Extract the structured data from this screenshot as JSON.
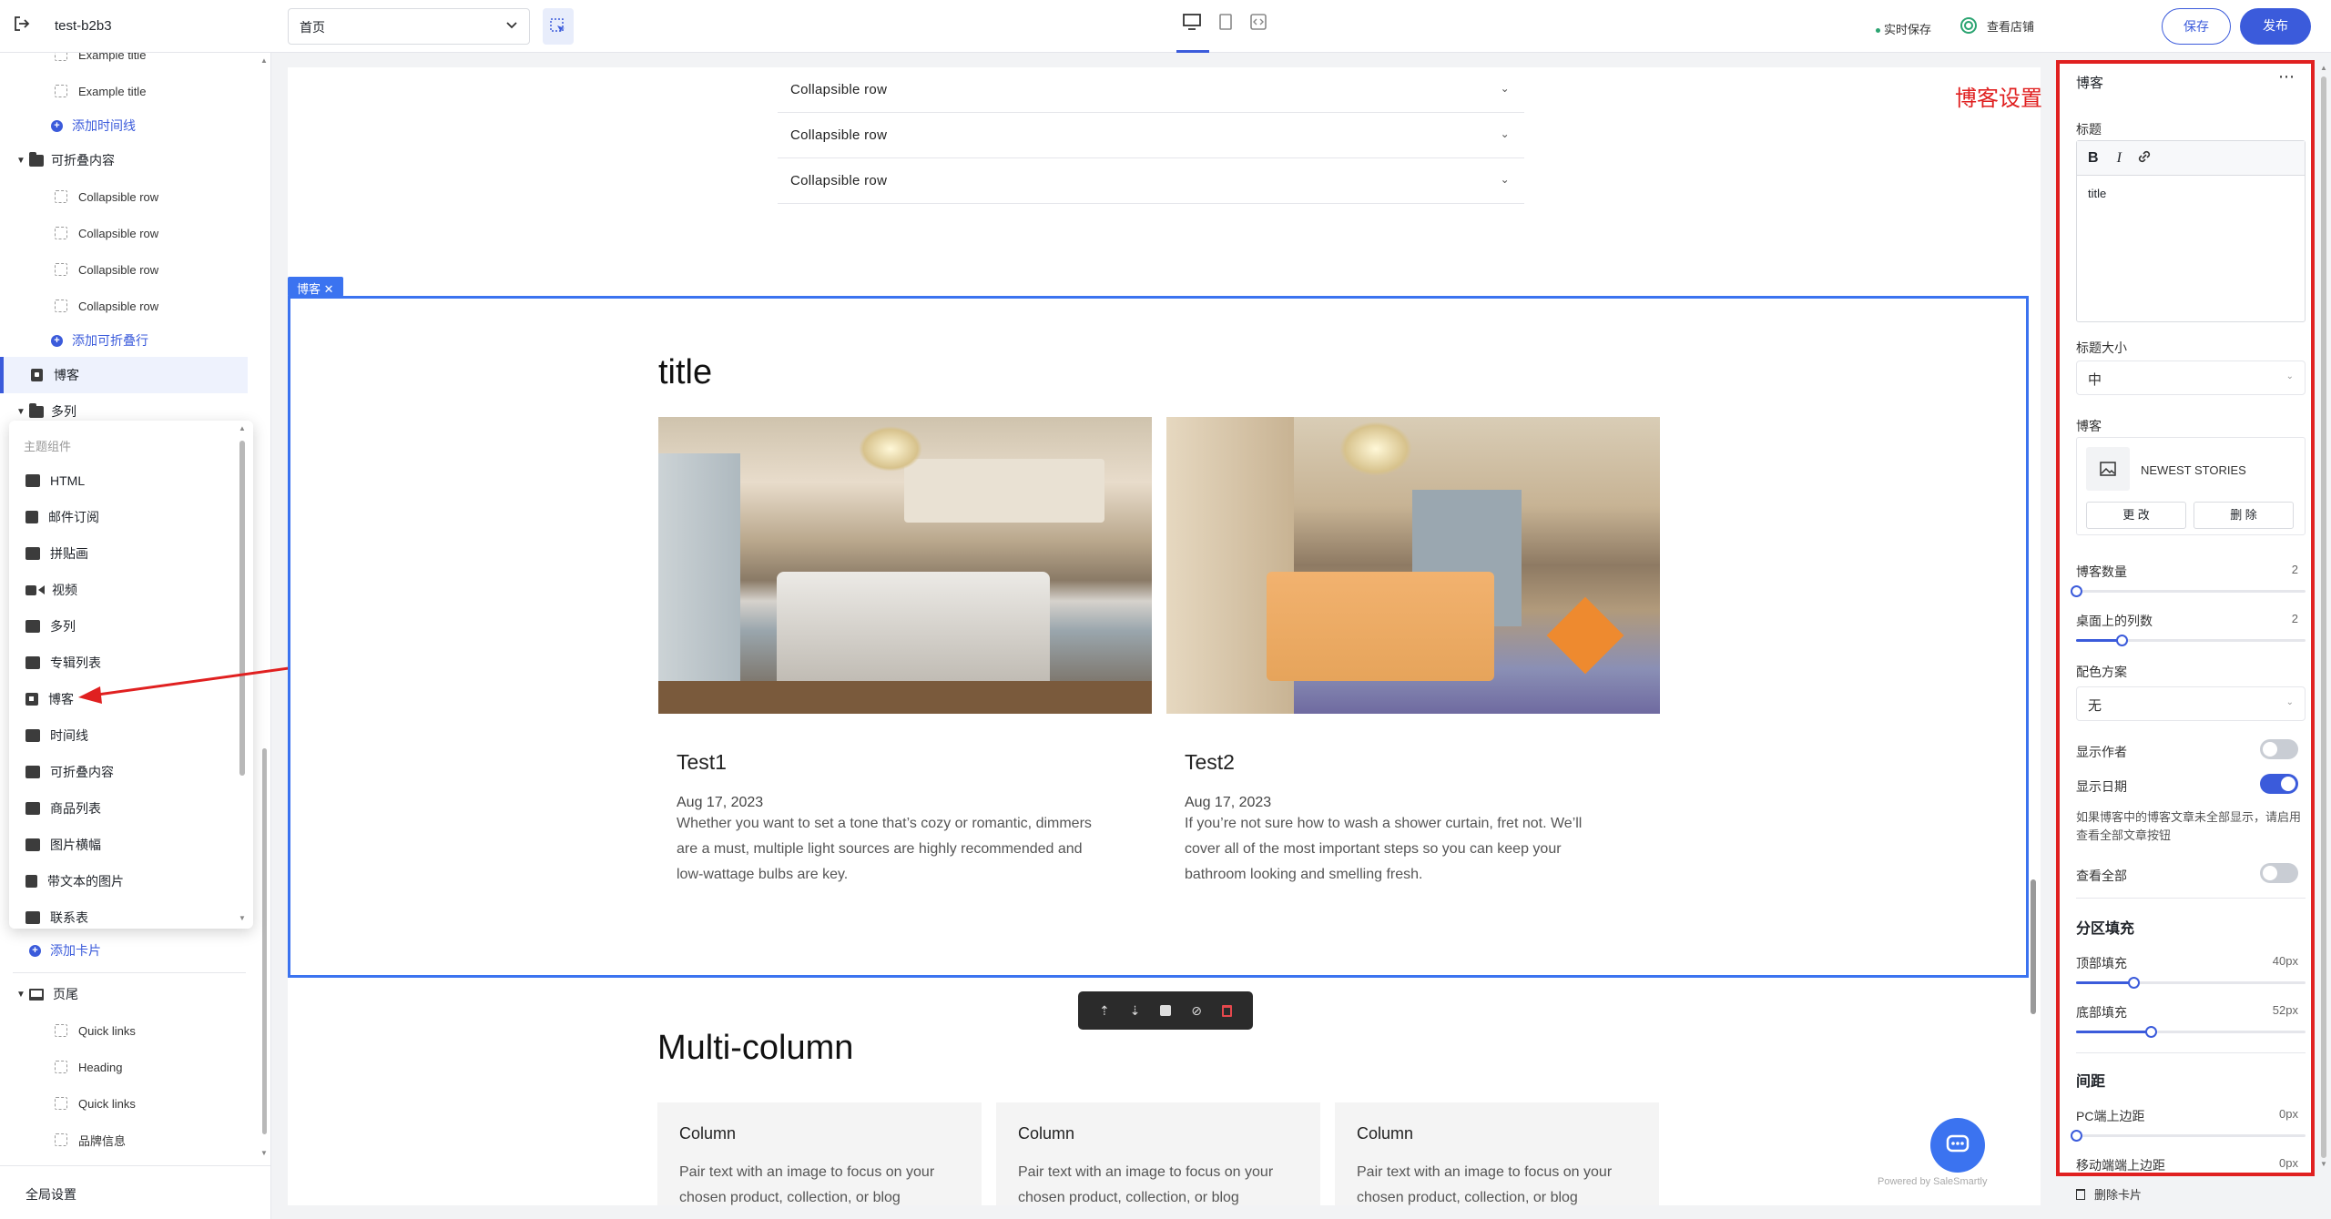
{
  "header": {
    "store_name": "test-b2b3",
    "page_select": "首页",
    "realtime_save": "实时保存",
    "view_store": "查看店铺",
    "save": "保存",
    "publish": "发布"
  },
  "left_tree": {
    "example1": "Example title",
    "example2": "Example title",
    "add_timeline": "添加时间线",
    "collapsible_group": "可折叠内容",
    "rows": [
      "Collapsible row",
      "Collapsible row",
      "Collapsible row",
      "Collapsible row"
    ],
    "add_collapsible": "添加可折叠行",
    "blog": "博客",
    "multicol": "多列",
    "add_card": "添加卡片",
    "footer": "页尾",
    "footer_items": [
      "Quick links",
      "Heading",
      "Quick links",
      "品牌信息"
    ],
    "global_settings": "全局设置"
  },
  "popup": {
    "header": "主题组件",
    "items": [
      "HTML",
      "邮件订阅",
      "拼贴画",
      "视频",
      "多列",
      "专辑列表",
      "博客",
      "时间线",
      "可折叠内容",
      "商品列表",
      "图片横幅",
      "带文本的图片",
      "联系表"
    ]
  },
  "canvas": {
    "collapsible_rows": [
      "Collapsible row",
      "Collapsible row",
      "Collapsible row"
    ],
    "blog_badge": "博客",
    "blog_title": "title",
    "posts": [
      {
        "title": "Test1",
        "date": "Aug 17, 2023",
        "excerpt": [
          "Whether you want to set a tone that’s cozy or romantic, dimmers",
          "are a must, multiple light sources are highly recommended and",
          "low-wattage bulbs are key."
        ]
      },
      {
        "title": "Test2",
        "date": "Aug 17, 2023",
        "excerpt": [
          "If you’re not sure how to wash a shower curtain, fret not. We’ll",
          "cover all of the most important steps so you can keep your",
          "bathroom looking and smelling fresh."
        ]
      }
    ],
    "multicolumn_title": "Multi-column",
    "columns": [
      {
        "heading": "Column",
        "text": [
          "Pair text with an image to focus on your",
          "chosen product, collection, or blog"
        ]
      },
      {
        "heading": "Column",
        "text": [
          "Pair text with an image to focus on your",
          "chosen product, collection, or blog"
        ]
      },
      {
        "heading": "Column",
        "text": [
          "Pair text with an image to focus on your",
          "chosen product, collection, or blog"
        ]
      }
    ],
    "powered_by": "Powered by SaleSmartly"
  },
  "annotation": "博客设置",
  "settings": {
    "title": "博客",
    "heading_label": "标题",
    "heading_value": "title",
    "heading_size_label": "标题大小",
    "heading_size_value": "中",
    "blog_label": "博客",
    "blog_name": "NEWEST STORIES",
    "change": "更 改",
    "delete": "删 除",
    "post_count_label": "博客数量",
    "post_count": "2",
    "post_count_fraction": 0.0,
    "desktop_cols_label": "桌面上的列数",
    "desktop_cols": "2",
    "desktop_cols_fraction": 0.2,
    "color_scheme_label": "配色方案",
    "color_scheme_value": "无",
    "show_author_label": "显示作者",
    "show_author": false,
    "show_date_label": "显示日期",
    "show_date": true,
    "info_text": "如果博客中的博客文章未全部显示，请启用查看全部文章按钮",
    "view_all_label": "查看全部",
    "view_all": false,
    "section_padding": "分区填充",
    "top_padding_label": "顶部填充",
    "top_padding": "40px",
    "top_padding_fraction": 0.25,
    "bottom_padding_label": "底部填充",
    "bottom_padding": "52px",
    "bottom_padding_fraction": 0.325,
    "spacing": "间距",
    "pc_top_margin_label": "PC端上边距",
    "pc_top_margin": "0px",
    "mobile_top_margin_label": "移动端端上边距",
    "mobile_top_margin": "0px",
    "delete_card": "删除卡片"
  },
  "colors": {
    "accent": "#3b5bdb",
    "selection": "#3b73f0",
    "annotation": "#e02020"
  }
}
